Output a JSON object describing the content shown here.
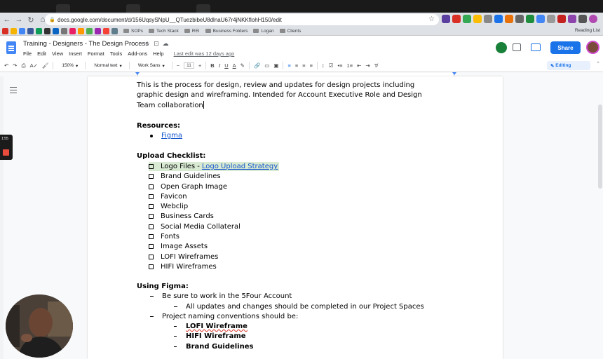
{
  "browser": {
    "url": "docs.google.com/document/d/156UqsySNpU__QTuezbibeU8dlnaU67r4jNKKflohH150/edit",
    "bookmarks": [
      "SOPs",
      "Tech Stack",
      "REI",
      "Business Folders",
      "Logan",
      "Clients"
    ],
    "reading_list": "Reading List"
  },
  "docs": {
    "title": "Training - Designers - The Design Process",
    "menu": [
      "File",
      "Edit",
      "View",
      "Insert",
      "Format",
      "Tools",
      "Add-ons",
      "Help"
    ],
    "last_edit": "Last edit was 12 days ago",
    "share_label": "Share"
  },
  "toolbar": {
    "zoom": "150%",
    "style": "Normal text",
    "font": "Work Sans",
    "font_size": "11",
    "mode": "Editing"
  },
  "recorder": {
    "time": "1:55"
  },
  "document": {
    "intro_lines": [
      "This is the process for design, review and updates for design projects including",
      "graphic design and wireframing.  Intended for Account Executive Role and Design",
      "Team collaboration"
    ],
    "resources_heading": "Resources:",
    "resources": [
      "Figma"
    ],
    "checklist_heading": "Upload Checklist:",
    "checklist_first_prefix": "Logo Files - ",
    "checklist_first_link": "Logo Upload Strategy",
    "checklist": [
      "Brand Guidelines",
      "Open Graph Image",
      "Favicon",
      "Webclip",
      "Business Cards",
      "Social Media Collateral",
      "Fonts",
      "Image Assets",
      "LOFI Wireframes",
      "HIFI Wireframes"
    ],
    "figma_heading": "Using Figma:",
    "figma_item1": "Be sure to work in the 5Four Account",
    "figma_sub1": "All updates and changes should be completed in our Project Spaces",
    "figma_item2": "Project naming conventions should be:",
    "naming": [
      "LOFI Wireframe",
      "HIFI Wireframe",
      "Brand Guidelines"
    ]
  },
  "colors": {
    "accent": "#1a73e8",
    "link": "#1155cc",
    "highlight": "#d9ead3"
  }
}
